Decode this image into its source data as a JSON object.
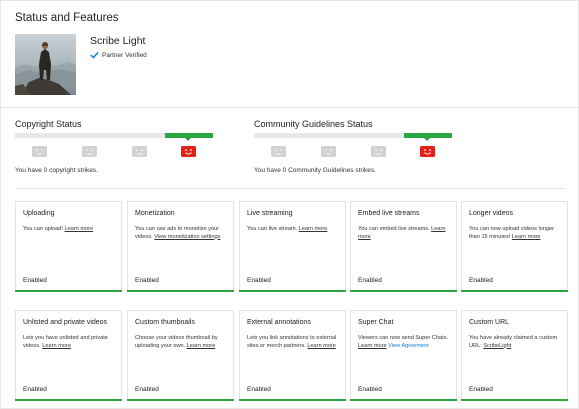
{
  "header": {
    "title": "Status and Features"
  },
  "channel": {
    "name": "Scribe Light",
    "verified_label": "Partner Verified"
  },
  "copyright": {
    "title": "Copyright Status",
    "text": "You have 0 copyright strikes.",
    "strikes": 0
  },
  "community": {
    "title": "Community Guidelines Status",
    "text": "You have 0 Community Guidelines strikes.",
    "strikes": 0
  },
  "colors": {
    "enabled_bar": "#2ba640",
    "strike_active": "#e62117",
    "strike_inactive": "#d2d2d2"
  },
  "features": [
    {
      "title": "Uploading",
      "desc": "You can upload! ",
      "link": "Learn more",
      "extra": "",
      "status": "Enabled"
    },
    {
      "title": "Monetization",
      "desc": "You can use ads to monetize your videos. ",
      "link": "View monetization settings",
      "extra": "",
      "status": "Enabled"
    },
    {
      "title": "Live streaming",
      "desc": "You can live stream. ",
      "link": "Learn more",
      "extra": "",
      "status": "Enabled"
    },
    {
      "title": "Embed live streams",
      "desc": "You can embed live streams. ",
      "link": "Learn more",
      "extra": "",
      "status": "Enabled"
    },
    {
      "title": "Longer videos",
      "desc": "You can now upload videos longer than 15 minutes! ",
      "link": "Learn more",
      "extra": "",
      "status": "Enabled"
    },
    {
      "title": "Unlisted and private videos",
      "desc": "Lets you have unlisted and private videos. ",
      "link": "Learn more",
      "extra": "",
      "status": "Enabled"
    },
    {
      "title": "Custom thumbnails",
      "desc": "Choose your videos thumbnail by uploading your own. ",
      "link": "Learn more",
      "extra": "",
      "status": "Enabled"
    },
    {
      "title": "External annotations",
      "desc": "Lets you link annotations to external sites or merch partners. ",
      "link": "Learn more",
      "extra": "",
      "status": "Enabled"
    },
    {
      "title": "Super Chat",
      "desc": "Viewers can now send Super Chats. ",
      "link": "Learn more",
      "extra": "View Agreement",
      "status": "Enabled"
    },
    {
      "title": "Custom URL",
      "desc": "You have already claimed a custom URL: ",
      "link": "ScribeLight",
      "extra": "",
      "status": "Enabled"
    }
  ]
}
